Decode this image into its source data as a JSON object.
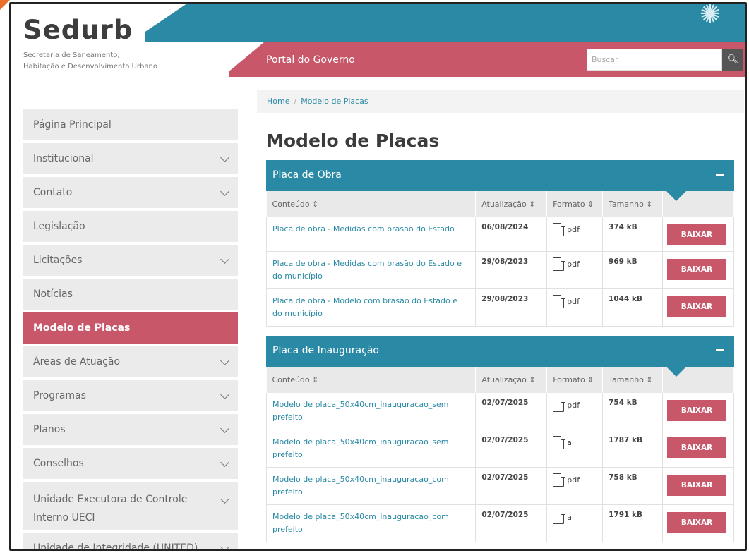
{
  "site": {
    "logo": "Sedurb",
    "subtitle": "Secretaria de Saneamento, Habitação e Desenvolvimento Urbano",
    "portal_link": "Portal do Governo",
    "search_placeholder": "Buscar",
    "accent_blue": "#2a8aa5",
    "accent_red": "#c8576a"
  },
  "sidebar": {
    "items": [
      {
        "label": "Página Principal",
        "expandable": false,
        "active": false
      },
      {
        "label": "Institucional",
        "expandable": true,
        "active": false
      },
      {
        "label": "Contato",
        "expandable": true,
        "active": false
      },
      {
        "label": "Legislação",
        "expandable": false,
        "active": false
      },
      {
        "label": "Licitações",
        "expandable": true,
        "active": false
      },
      {
        "label": "Notícias",
        "expandable": false,
        "active": false
      },
      {
        "label": "Modelo de Placas",
        "expandable": false,
        "active": true
      },
      {
        "label": "Áreas de Atuação",
        "expandable": true,
        "active": false
      },
      {
        "label": "Programas",
        "expandable": true,
        "active": false
      },
      {
        "label": "Planos",
        "expandable": true,
        "active": false
      },
      {
        "label": "Conselhos",
        "expandable": true,
        "active": false
      },
      {
        "label": "Unidade Executora de Controle Interno UECI",
        "expandable": true,
        "active": false
      },
      {
        "label": "Unidade de Integridade (UNITED)",
        "expandable": true,
        "active": false
      }
    ]
  },
  "breadcrumb": {
    "home": "Home",
    "separator": "/",
    "current": "Modelo de Placas"
  },
  "page_title": "Modelo de Placas",
  "columns": {
    "content": "Conteúdo ⇕",
    "updated": "Atualização ⇕",
    "format": "Formato ⇕",
    "size": "Tamanho ⇕"
  },
  "download_label": "BAIXAR",
  "panels": [
    {
      "title": "Placa de Obra",
      "rows": [
        {
          "name": "Placa de obra - Medidas com brasão do Estado",
          "date": "06/08/2024",
          "format": "pdf",
          "size": "374 kB"
        },
        {
          "name": "Placa de obra - Medidas com brasão do Estado e do município",
          "date": "29/08/2023",
          "format": "pdf",
          "size": "969 kB"
        },
        {
          "name": "Placa de obra - Modelo com brasão do Estado e do município",
          "date": "29/08/2023",
          "format": "pdf",
          "size": "1044 kB"
        }
      ]
    },
    {
      "title": "Placa de Inauguração",
      "rows": [
        {
          "name": "Modelo de placa_50x40cm_inauguracao_sem prefeito",
          "date": "02/07/2025",
          "format": "pdf",
          "size": "754 kB"
        },
        {
          "name": "Modelo de placa_50x40cm_inauguracao_sem prefeito",
          "date": "02/07/2025",
          "format": "ai",
          "size": "1787 kB"
        },
        {
          "name": "Modelo de placa_50x40cm_inauguracao_com prefeito",
          "date": "02/07/2025",
          "format": "pdf",
          "size": "758 kB"
        },
        {
          "name": "Modelo de placa_50x40cm_inauguracao_com prefeito",
          "date": "02/07/2025",
          "format": "ai",
          "size": "1791 kB"
        }
      ]
    }
  ]
}
